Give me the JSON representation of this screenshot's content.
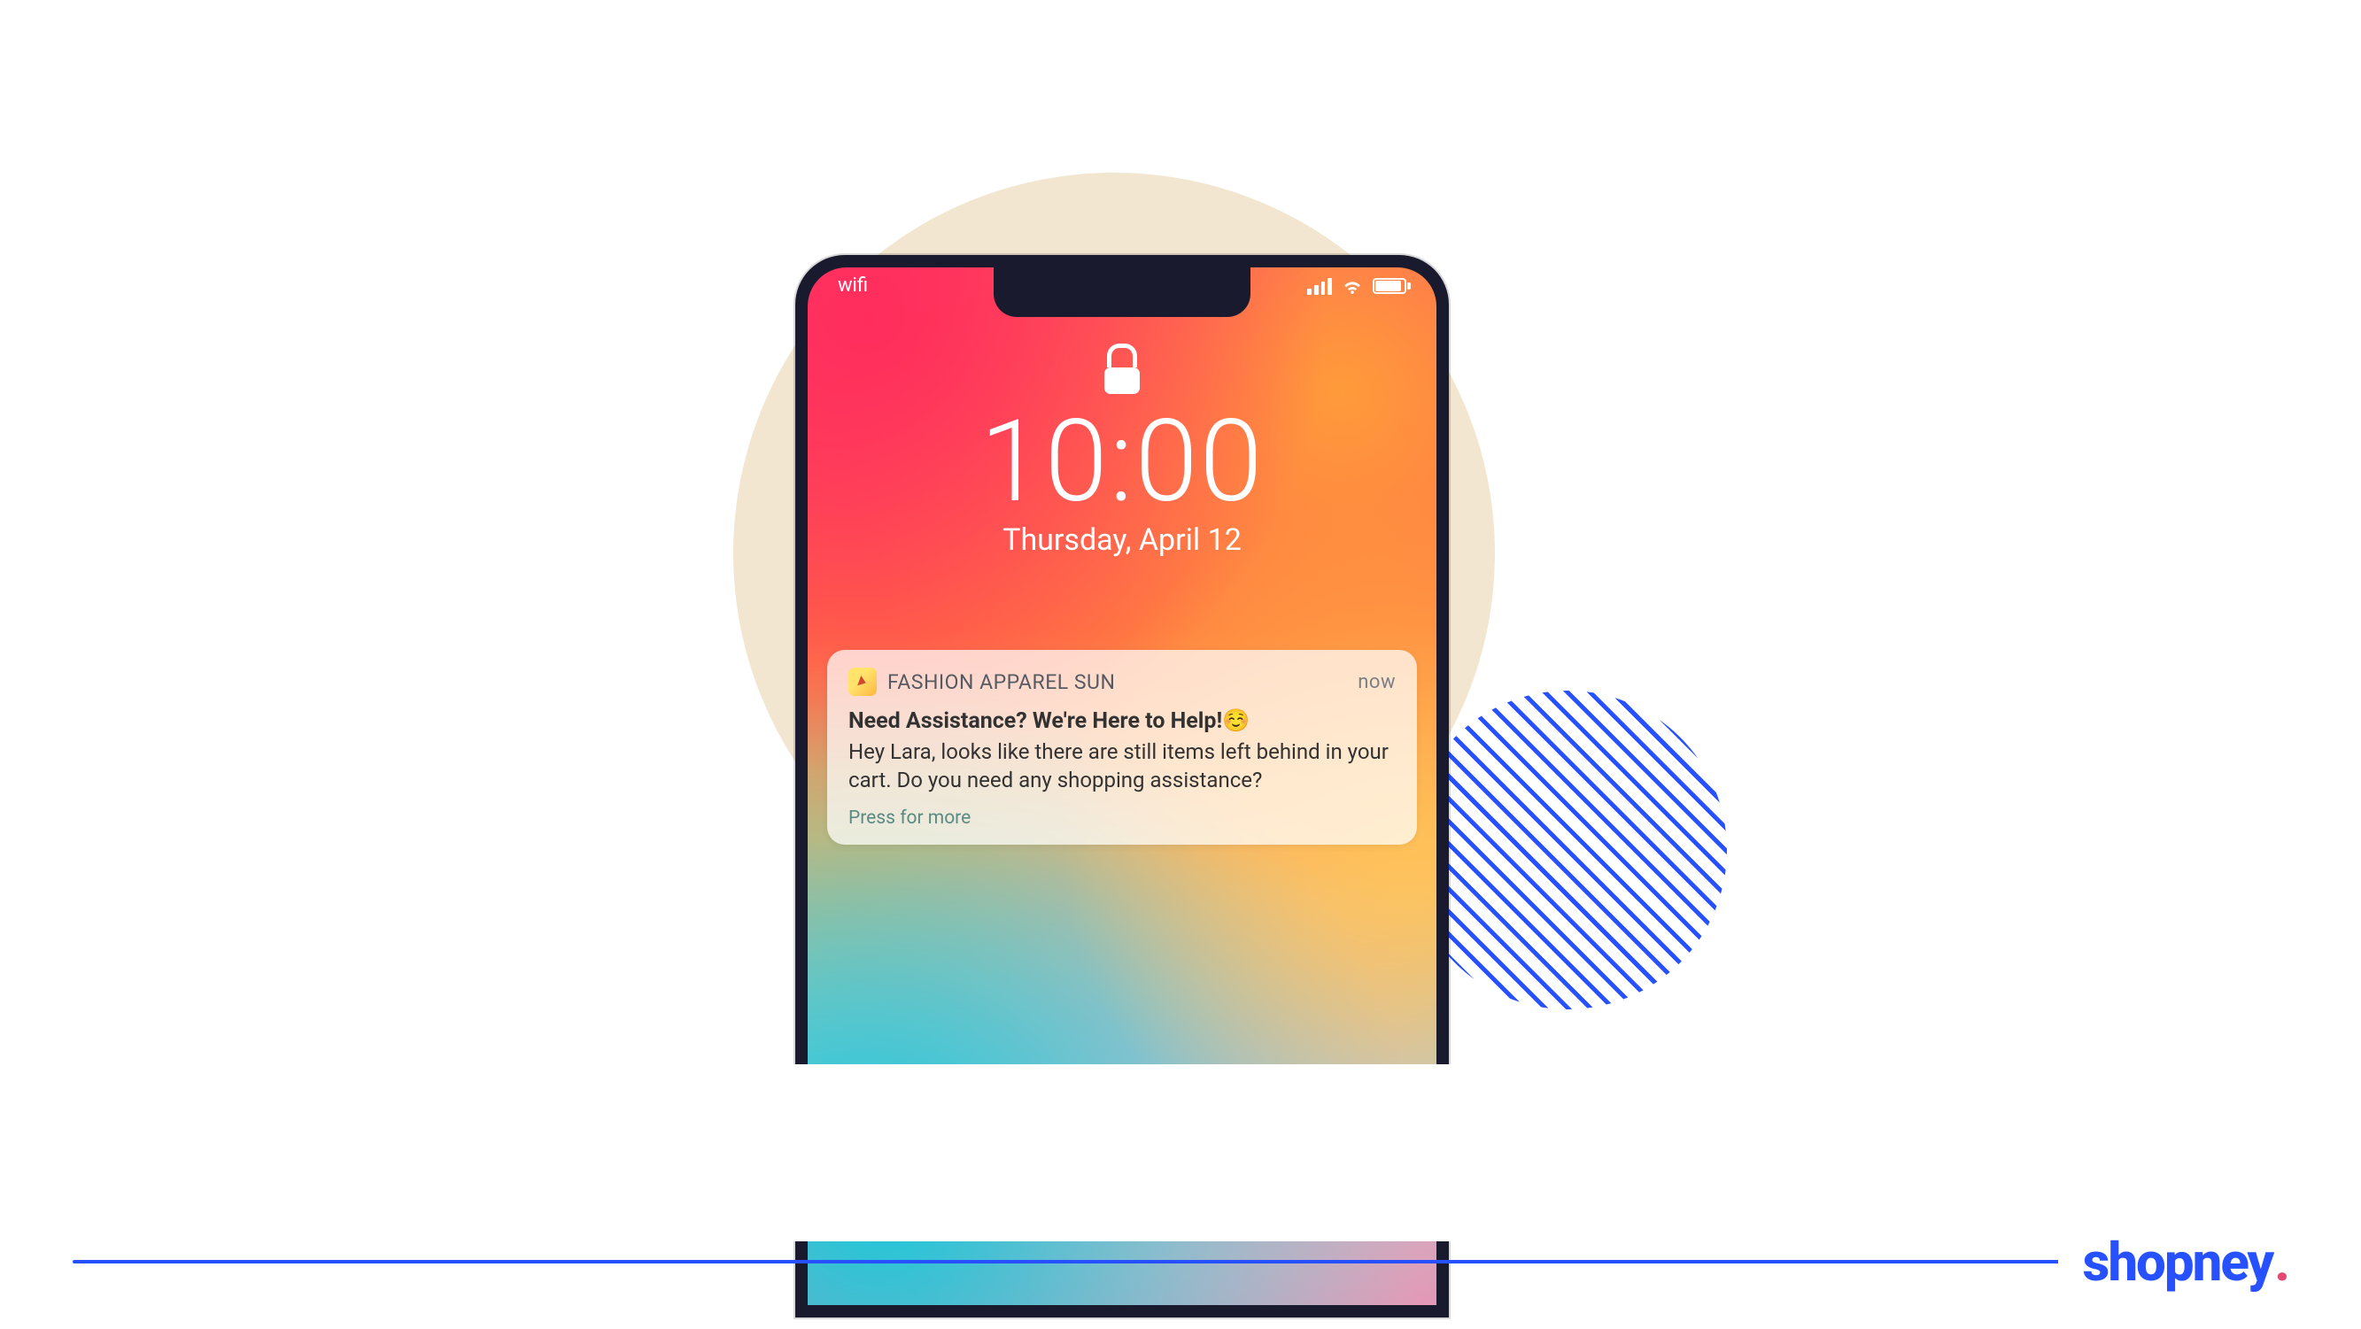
{
  "status_bar": {
    "wifi_label": "wifi",
    "signal_icon_name": "cellular-signal-icon",
    "wifi_icon_name": "wifi-icon",
    "battery_icon_name": "battery-full-icon"
  },
  "lockscreen": {
    "lock_icon_name": "lock-icon",
    "time": "10:00",
    "date": "Thursday, April 12"
  },
  "notification": {
    "app_icon_name": "fashion-apparel-sun-app-icon",
    "app_name": "FASHION APPAREL SUN",
    "timestamp": "now",
    "title": "Need Assistance? We're Here to Help!☺️",
    "body": "Hey Lara, looks like there are still items left behind in your cart. Do you need any shopping assistance?",
    "action_label": "Press for more"
  },
  "footer": {
    "brand_name": "shopney",
    "brand_dot": "."
  },
  "colors": {
    "brand_blue": "#2751ff",
    "brand_pink": "#e54872",
    "decorative_cream": "#f2e6d0"
  }
}
